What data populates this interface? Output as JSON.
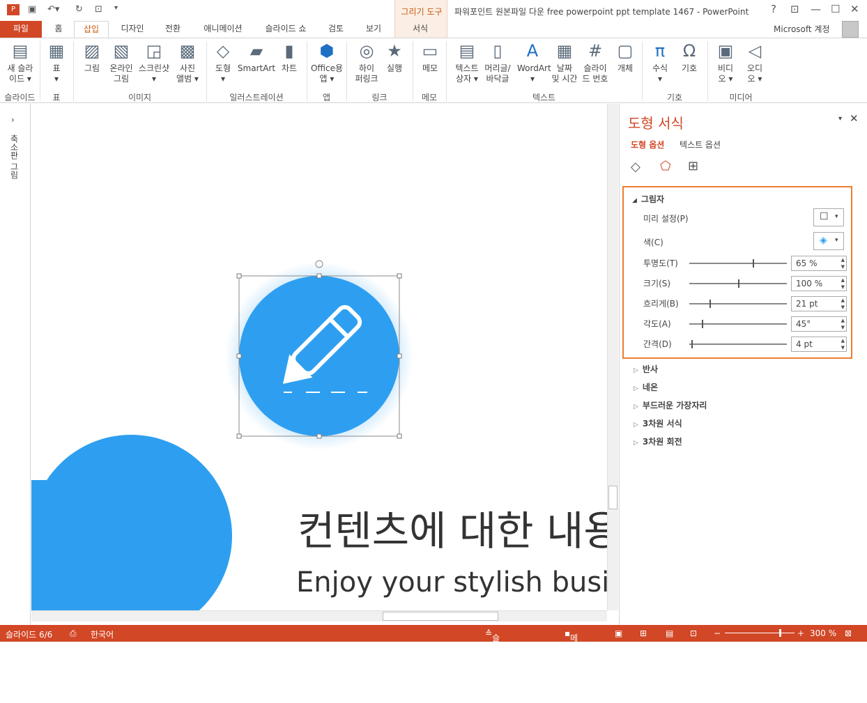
{
  "app": {
    "title": "파워포인트 원본파일 다운 free powerpoint ppt template 1467 - PowerPoint",
    "tools_label": "그리기 도구",
    "account": "Microsoft 계정"
  },
  "tabs": [
    "파일",
    "홈",
    "삽입",
    "디자인",
    "전환",
    "애니메이션",
    "슬라이드 쇼",
    "검토",
    "보기",
    "서식"
  ],
  "ribbon": {
    "buttons": [
      {
        "label": "새 슬라\n이드 ▾",
        "icon": "new-slide-icon"
      },
      {
        "label": "표\n▾",
        "icon": "table-icon"
      },
      {
        "label": "그림",
        "icon": "picture-icon"
      },
      {
        "label": "온라인\n그림",
        "icon": "online-picture-icon"
      },
      {
        "label": "스크린샷\n▾",
        "icon": "screenshot-icon"
      },
      {
        "label": "사진\n앨범 ▾",
        "icon": "photo-album-icon"
      },
      {
        "label": "도형\n▾",
        "icon": "shapes-icon"
      },
      {
        "label": "SmartArt",
        "icon": "smartart-icon"
      },
      {
        "label": "차트",
        "icon": "chart-icon"
      },
      {
        "label": "Office용\n앱 ▾",
        "icon": "office-apps-icon"
      },
      {
        "label": "하이\n퍼링크",
        "icon": "hyperlink-icon"
      },
      {
        "label": "실행",
        "icon": "action-icon"
      },
      {
        "label": "메모",
        "icon": "comment-icon"
      },
      {
        "label": "텍스트\n상자 ▾",
        "icon": "textbox-icon"
      },
      {
        "label": "머리글/\n바닥글",
        "icon": "header-footer-icon"
      },
      {
        "label": "WordArt\n▾",
        "icon": "wordart-icon"
      },
      {
        "label": "날짜\n및 시간",
        "icon": "date-time-icon"
      },
      {
        "label": "슬라이\n드 번호",
        "icon": "slide-number-icon"
      },
      {
        "label": "개체",
        "icon": "object-icon"
      },
      {
        "label": "수식\n▾",
        "icon": "equation-icon"
      },
      {
        "label": "기호",
        "icon": "symbol-icon"
      },
      {
        "label": "비디\n오 ▾",
        "icon": "video-icon"
      },
      {
        "label": "오디\n오 ▾",
        "icon": "audio-icon"
      }
    ],
    "groups": [
      "슬라이드",
      "표",
      "이미지",
      "일러스트레이션",
      "앱",
      "링크",
      "메모",
      "텍스트",
      "기호",
      "미디어"
    ]
  },
  "thumbnails_label": "축소판 그림",
  "slide": {
    "title": "컨텐츠에 대한 내용",
    "subtitle": "Enjoy your stylish business"
  },
  "pane": {
    "title": "도형 서식",
    "tab_shape": "도형 옵션",
    "tab_text": "텍스트 옵션",
    "section": "그림자",
    "preset_label": "미리 설정(P)",
    "color_label": "색(C)",
    "rows": [
      {
        "label": "투명도(T)",
        "value": "65 %",
        "level": 0.65
      },
      {
        "label": "크기(S)",
        "value": "100 %",
        "level": 0.5
      },
      {
        "label": "흐리게(B)",
        "value": "21 pt",
        "level": 0.21
      },
      {
        "label": "각도(A)",
        "value": "45°",
        "level": 0.125
      },
      {
        "label": "간격(D)",
        "value": "4 pt",
        "level": 0.02
      }
    ],
    "collapsed": [
      "반사",
      "네온",
      "부드러운 가장자리",
      "3차원 서식",
      "3차원 회전"
    ]
  },
  "status": {
    "slide": "슬라이드 6/6",
    "lang": "한국어",
    "notes": "슬라이드 노트",
    "comments": "메모",
    "zoom": "300 %"
  },
  "colors": {
    "accent": "#d24726",
    "shape": "#2e9ff0",
    "highlight": "#ed7d31"
  }
}
